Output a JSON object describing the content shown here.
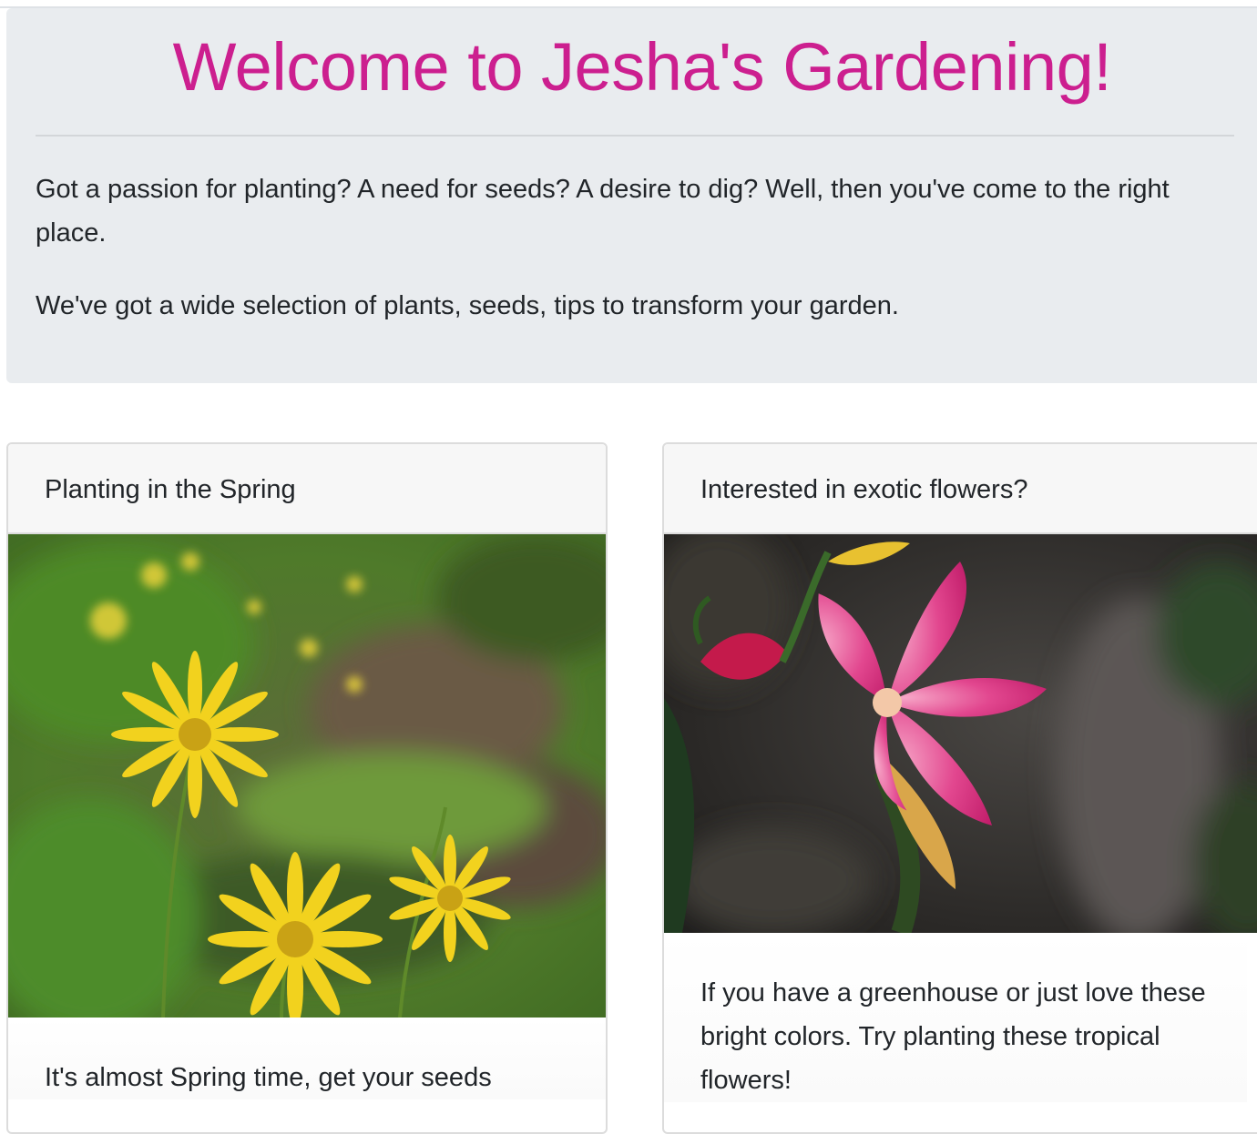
{
  "jumbotron": {
    "title": "Welcome to Jesha's Gardening!",
    "lead_1": "Got a passion for planting? A need for seeds? A desire to dig? Well, then you've come to the right place.",
    "lead_2": "We've got a wide selection of plants, seeds, tips to transform your garden."
  },
  "cards": [
    {
      "header": "Planting in the Spring",
      "image": "yellow-daisy-flowers-photo",
      "body": "It's almost Spring time, get your seeds"
    },
    {
      "header": "Interested in exotic flowers?",
      "image": "pink-desert-rose-flower-photo",
      "body": "If you have a greenhouse or just love these bright colors. Try planting these tropical flowers!"
    }
  ],
  "colors": {
    "title": "#cc1f8f",
    "jumbotron_bg": "#e9ecef",
    "card_header_bg": "#f7f7f7"
  }
}
